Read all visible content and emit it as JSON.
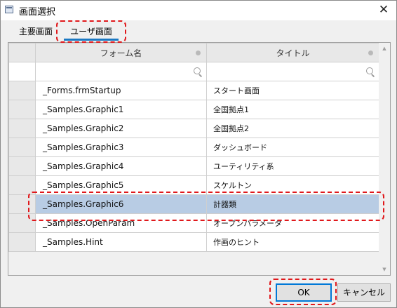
{
  "window": {
    "title": "画面選択",
    "close_glyph": "✕"
  },
  "tabs": [
    {
      "label": "主要画面",
      "active": false
    },
    {
      "label": "ユーザ画面",
      "active": true
    }
  ],
  "grid": {
    "columns": [
      "フォーム名",
      "タイトル"
    ],
    "rows": [
      {
        "form": "_Forms.frmStartup",
        "title": "スタート画面",
        "selected": false
      },
      {
        "form": "_Samples.Graphic1",
        "title": "全国拠点1",
        "selected": false
      },
      {
        "form": "_Samples.Graphic2",
        "title": "全国拠点2",
        "selected": false
      },
      {
        "form": "_Samples.Graphic3",
        "title": "ダッシュボード",
        "selected": false
      },
      {
        "form": "_Samples.Graphic4",
        "title": "ユーティリティ系",
        "selected": false
      },
      {
        "form": "_Samples.Graphic5",
        "title": "スケルトン",
        "selected": false
      },
      {
        "form": "_Samples.Graphic6",
        "title": "計器類",
        "selected": true
      },
      {
        "form": "_Samples.OpenParam",
        "title": "オープンパラメータ",
        "selected": false
      },
      {
        "form": "_Samples.Hint",
        "title": "作画のヒント",
        "selected": false
      }
    ],
    "scroll_up_glyph": "▲",
    "scroll_down_glyph": "▼"
  },
  "buttons": {
    "ok": "OK",
    "cancel": "キャンセル"
  },
  "colors": {
    "selection": "#b8cce4",
    "accent": "#1a78c2",
    "highlight": "#e0181b"
  }
}
